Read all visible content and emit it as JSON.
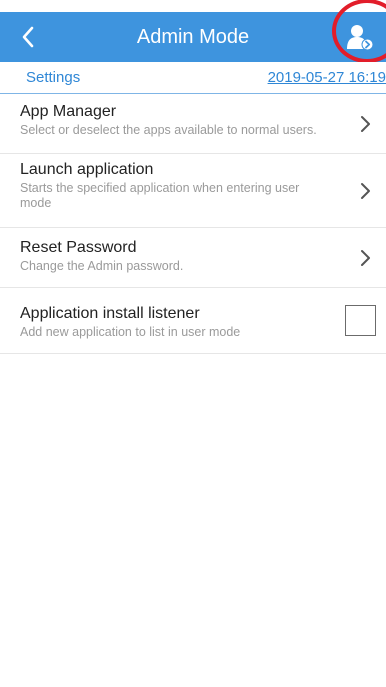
{
  "app_bar": {
    "title": "Admin Mode",
    "color": "#3e94de",
    "back_icon": "chevron-left-icon",
    "action_icon": "user-switch-icon",
    "highlight_color": "#e21d2a"
  },
  "subheader": {
    "title": "Settings",
    "date": "2019-05-27 16:19",
    "color": "#2f87d6"
  },
  "settings": [
    {
      "title": "App Manager",
      "description": "Select or deselect the apps available to normal users.",
      "control": "chevron-right-icon"
    },
    {
      "title": "Launch application",
      "description": "Starts the specified application when entering user mode",
      "control": "chevron-right-icon"
    },
    {
      "title": "Reset Password",
      "description": "Change the Admin password.",
      "control": "chevron-right-icon"
    },
    {
      "title": "Application install listener",
      "description": "Add new application to list in user mode",
      "control": "checkbox",
      "checked": false
    }
  ]
}
